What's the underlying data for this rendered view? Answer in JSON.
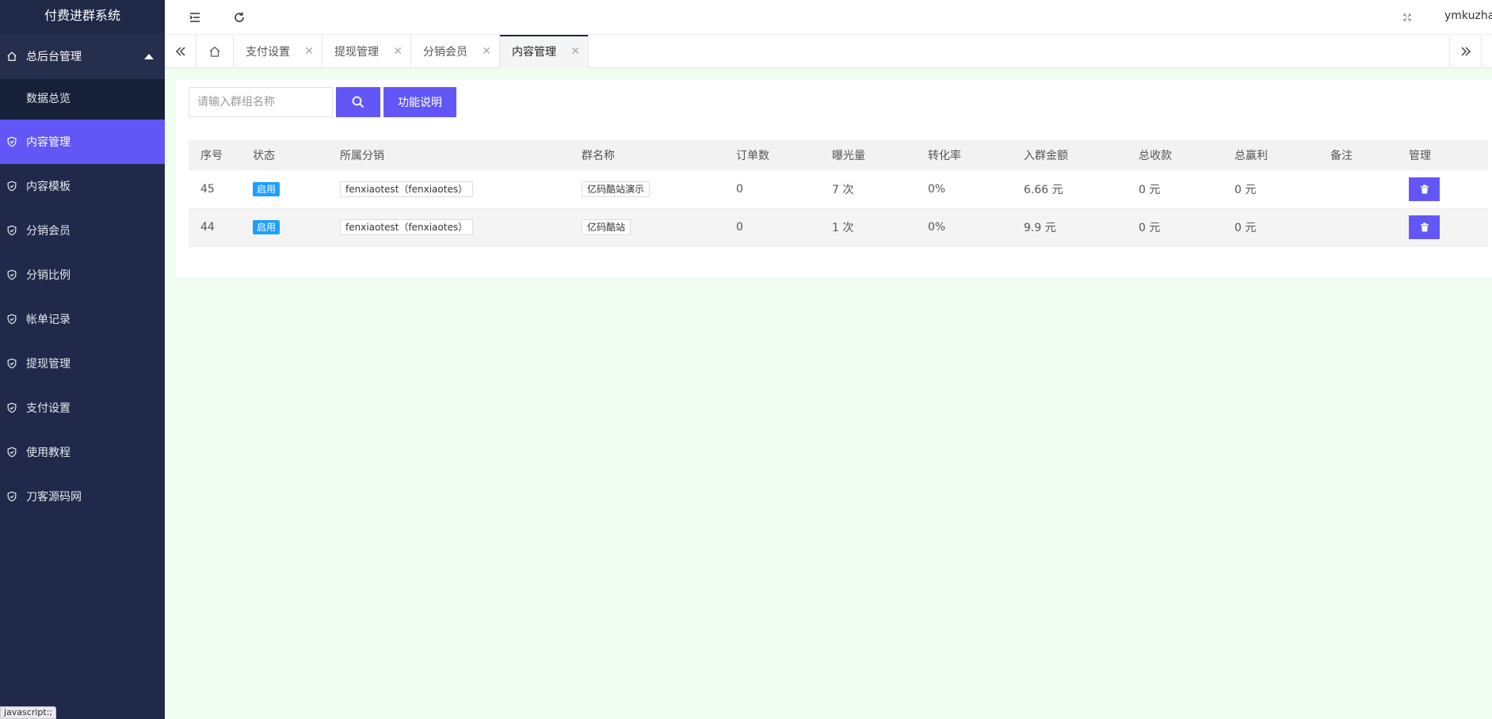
{
  "app": {
    "title": "付费进群系统"
  },
  "sidebar": {
    "group_label": "总后台管理",
    "sub_item": "数据总览",
    "items": [
      {
        "label": "内容管理",
        "active": true
      },
      {
        "label": "内容模板"
      },
      {
        "label": "分销会员"
      },
      {
        "label": "分销比例"
      },
      {
        "label": "帐单记录"
      },
      {
        "label": "提现管理"
      },
      {
        "label": "支付设置"
      },
      {
        "label": "使用教程"
      },
      {
        "label": "刀客源码网"
      }
    ]
  },
  "header": {
    "username": "ymkuzhan"
  },
  "tabs": [
    {
      "label": "支付设置"
    },
    {
      "label": "提现管理"
    },
    {
      "label": "分销会员"
    },
    {
      "label": "内容管理",
      "active": true
    }
  ],
  "search": {
    "placeholder": "请输入群组名称",
    "help_label": "功能说明"
  },
  "table": {
    "headers": [
      "序号",
      "状态",
      "所属分销",
      "群名称",
      "订单数",
      "曝光量",
      "转化率",
      "入群金额",
      "总收款",
      "总赢利",
      "备注",
      "管理"
    ],
    "rows": [
      {
        "id": "45",
        "status": "启用",
        "distributor": "fenxiaotest（fenxiaotes）",
        "group": "亿码酷站演示",
        "orders": "0",
        "views": "7 次",
        "rate": "0%",
        "amount": "6.66 元",
        "income": "0 元",
        "profit": "0 元",
        "remark": ""
      },
      {
        "id": "44",
        "status": "启用",
        "distributor": "fenxiaotest（fenxiaotes）",
        "group": "亿码酷站",
        "orders": "0",
        "views": "1 次",
        "rate": "0%",
        "amount": "9.9 元",
        "income": "0 元",
        "profit": "0 元",
        "remark": ""
      }
    ]
  },
  "status_bar": {
    "text": "javascript:;"
  },
  "colors": {
    "sidebar": "#20294a",
    "accent": "#6257f6",
    "badge": "#1e9fff"
  }
}
